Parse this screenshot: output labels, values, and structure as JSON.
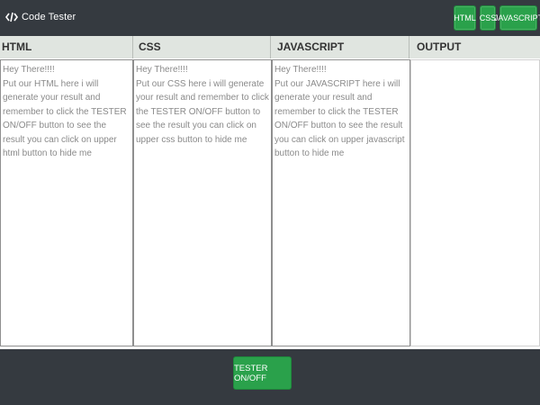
{
  "app": {
    "title": "Code Tester"
  },
  "toggles": {
    "html_label": "HTML",
    "css_label": "CSS",
    "js_label": "JAVASCRIPT"
  },
  "panels": {
    "html": {
      "header": "HTML",
      "text": "Hey There!!!!\nPut our HTML here i will generate your result and remember to click the TESTER ON/OFF button to see the result you can click on upper html button to hide me"
    },
    "css": {
      "header": "CSS",
      "text": "Hey There!!!!\nPut our CSS here i will generate your result and remember to click the TESTER ON/OFF button to see the result you can click on upper css button to hide me"
    },
    "js": {
      "header": "JAVASCRIPT",
      "text": "Hey There!!!!\nPut our JAVASCRIPT here i will generate your result and remember to click the TESTER ON/OFF button to see the result you can click on upper javascript button to hide me"
    },
    "output": {
      "header": "OUTPUT"
    }
  },
  "footer": {
    "tester_label": "TESTER ON/OFF"
  },
  "colors": {
    "bar": "#353a40",
    "accent": "#2aa14b",
    "header_bg": "#e0e5e0"
  },
  "icons": {
    "brand": "code-icon"
  }
}
